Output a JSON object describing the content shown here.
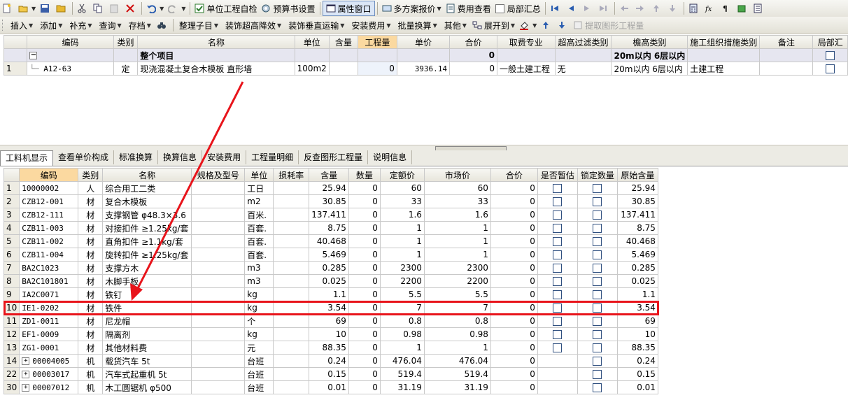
{
  "toolbar1": {
    "self_check": "单位工程自检",
    "budget_settings": "预算书设置",
    "property_window": "属性窗口",
    "multi_quote": "多方案报价",
    "fee_view": "费用查看",
    "partial_summary": "局部汇总"
  },
  "toolbar2": {
    "insert": "插入",
    "add": "添加",
    "supplement": "补充",
    "query": "查询",
    "archive": "存档",
    "organize": "整理子目",
    "decor_height": "装饰超高降效",
    "decor_transport": "装饰垂直运输",
    "install_fee": "安装费用",
    "batch_convert": "批量换算",
    "other": "其他",
    "expand_to": "展开到",
    "extract_qty": "提取图形工程量"
  },
  "top_grid": {
    "headers": [
      "编码",
      "类别",
      "名称",
      "单位",
      "含量",
      "工程量",
      "单价",
      "合价",
      "取费专业",
      "超高过滤类别",
      "檐高类别",
      "施工组织措施类别",
      "备注",
      "局部汇"
    ],
    "group_row": {
      "name": "整个项目",
      "total": "0",
      "eave": "20m以内 6层以内"
    },
    "rows": [
      {
        "num": "1",
        "code": "A12-63",
        "type": "定",
        "name": "现浇混凝土复合木模板 直形墙",
        "unit": "100m2",
        "content": "",
        "qty": "0",
        "price": "3936.14",
        "total": "0",
        "fee": "一般土建工程",
        "filter": "无",
        "eave": "20m以内 6层以内",
        "org": "土建工程",
        "note": ""
      }
    ]
  },
  "tabs": [
    "工料机显示",
    "查看单价构成",
    "标准换算",
    "换算信息",
    "安装费用",
    "工程量明细",
    "反查图形工程量",
    "说明信息"
  ],
  "bottom_grid": {
    "headers": [
      "编码",
      "类别",
      "名称",
      "规格及型号",
      "单位",
      "损耗率",
      "含量",
      "数量",
      "定额价",
      "市场价",
      "合价",
      "是否暂估",
      "锁定数量",
      "原始含量"
    ],
    "rows": [
      {
        "num": "1",
        "code": "10000002",
        "type": "人",
        "name": "综合用工二类",
        "spec": "",
        "unit": "工日",
        "loss": "",
        "content": "25.94",
        "amount": "0",
        "quota": "60",
        "market": "60",
        "total": "0",
        "temp": false,
        "lock": true,
        "orig": "25.94",
        "expand": false
      },
      {
        "num": "2",
        "code": "CZB12-001",
        "type": "材",
        "name": "复合木模板",
        "spec": "",
        "unit": "m2",
        "loss": "",
        "content": "30.85",
        "amount": "0",
        "quota": "33",
        "market": "33",
        "total": "0",
        "temp": true,
        "lock": true,
        "orig": "30.85",
        "expand": false
      },
      {
        "num": "3",
        "code": "CZB12-111",
        "type": "材",
        "name": "支撑钢管 φ48.3×3.6",
        "spec": "",
        "unit": "百米.",
        "loss": "",
        "content": "137.411",
        "amount": "0",
        "quota": "1.6",
        "market": "1.6",
        "total": "0",
        "temp": true,
        "lock": true,
        "orig": "137.411",
        "expand": false
      },
      {
        "num": "4",
        "code": "CZB11-003",
        "type": "材",
        "name": "对接扣件 ≥1.25kg/套",
        "spec": "",
        "unit": "百套.",
        "loss": "",
        "content": "8.75",
        "amount": "0",
        "quota": "1",
        "market": "1",
        "total": "0",
        "temp": true,
        "lock": true,
        "orig": "8.75",
        "expand": false
      },
      {
        "num": "5",
        "code": "CZB11-002",
        "type": "材",
        "name": "直角扣件 ≥1.1kg/套",
        "spec": "",
        "unit": "百套.",
        "loss": "",
        "content": "40.468",
        "amount": "0",
        "quota": "1",
        "market": "1",
        "total": "0",
        "temp": true,
        "lock": true,
        "orig": "40.468",
        "expand": false
      },
      {
        "num": "6",
        "code": "CZB11-004",
        "type": "材",
        "name": "旋转扣件 ≥1.25kg/套",
        "spec": "",
        "unit": "百套.",
        "loss": "",
        "content": "5.469",
        "amount": "0",
        "quota": "1",
        "market": "1",
        "total": "0",
        "temp": true,
        "lock": true,
        "orig": "5.469",
        "expand": false
      },
      {
        "num": "7",
        "code": "BA2C1023",
        "type": "材",
        "name": "支撑方木",
        "spec": "",
        "unit": "m3",
        "loss": "",
        "content": "0.285",
        "amount": "0",
        "quota": "2300",
        "market": "2300",
        "total": "0",
        "temp": true,
        "lock": true,
        "orig": "0.285",
        "expand": false
      },
      {
        "num": "8",
        "code": "BA2C101801",
        "type": "材",
        "name": "木脚手板",
        "spec": "",
        "unit": "m3",
        "loss": "",
        "content": "0.025",
        "amount": "0",
        "quota": "2200",
        "market": "2200",
        "total": "0",
        "temp": true,
        "lock": true,
        "orig": "0.025",
        "expand": false
      },
      {
        "num": "9",
        "code": "IA2C0071",
        "type": "材",
        "name": "铁钉",
        "spec": "",
        "unit": "kg",
        "loss": "",
        "content": "1.1",
        "amount": "0",
        "quota": "5.5",
        "market": "5.5",
        "total": "0",
        "temp": true,
        "lock": true,
        "orig": "1.1",
        "expand": false
      },
      {
        "num": "10",
        "code": "IE1-0202",
        "type": "材",
        "name": "铁件",
        "spec": "",
        "unit": "kg",
        "loss": "",
        "content": "3.54",
        "amount": "0",
        "quota": "7",
        "market": "7",
        "total": "0",
        "temp": true,
        "lock": true,
        "orig": "3.54",
        "expand": false
      },
      {
        "num": "11",
        "code": "ZD1-0011",
        "type": "材",
        "name": "尼龙帽",
        "spec": "",
        "unit": "个",
        "loss": "",
        "content": "69",
        "amount": "0",
        "quota": "0.8",
        "market": "0.8",
        "total": "0",
        "temp": true,
        "lock": true,
        "orig": "69",
        "expand": false
      },
      {
        "num": "12",
        "code": "EF1-0009",
        "type": "材",
        "name": "隔离剂",
        "spec": "",
        "unit": "kg",
        "loss": "",
        "content": "10",
        "amount": "0",
        "quota": "0.98",
        "market": "0.98",
        "total": "0",
        "temp": true,
        "lock": true,
        "orig": "10",
        "expand": false
      },
      {
        "num": "13",
        "code": "ZG1-0001",
        "type": "材",
        "name": "其他材料费",
        "spec": "",
        "unit": "元",
        "loss": "",
        "content": "88.35",
        "amount": "0",
        "quota": "1",
        "market": "1",
        "total": "0",
        "temp": true,
        "lock": true,
        "orig": "88.35",
        "expand": false
      },
      {
        "num": "14",
        "code": "00004005",
        "type": "机",
        "name": "载货汽车 5t",
        "spec": "",
        "unit": "台班",
        "loss": "",
        "content": "0.24",
        "amount": "0",
        "quota": "476.04",
        "market": "476.04",
        "total": "0",
        "temp": null,
        "lock": true,
        "orig": "0.24",
        "expand": true
      },
      {
        "num": "22",
        "code": "00003017",
        "type": "机",
        "name": "汽车式起重机 5t",
        "spec": "",
        "unit": "台班",
        "loss": "",
        "content": "0.15",
        "amount": "0",
        "quota": "519.4",
        "market": "519.4",
        "total": "0",
        "temp": null,
        "lock": true,
        "orig": "0.15",
        "expand": true
      },
      {
        "num": "30",
        "code": "00007012",
        "type": "机",
        "name": "木工圆锯机 φ500",
        "spec": "",
        "unit": "台班",
        "loss": "",
        "content": "0.01",
        "amount": "0",
        "quota": "31.19",
        "market": "31.19",
        "total": "0",
        "temp": null,
        "lock": true,
        "orig": "0.01",
        "expand": true
      }
    ]
  },
  "colors": {
    "highlight": "#e8141b",
    "header_selected": "#fbd9a0",
    "group_row": "#e6e6f0"
  }
}
